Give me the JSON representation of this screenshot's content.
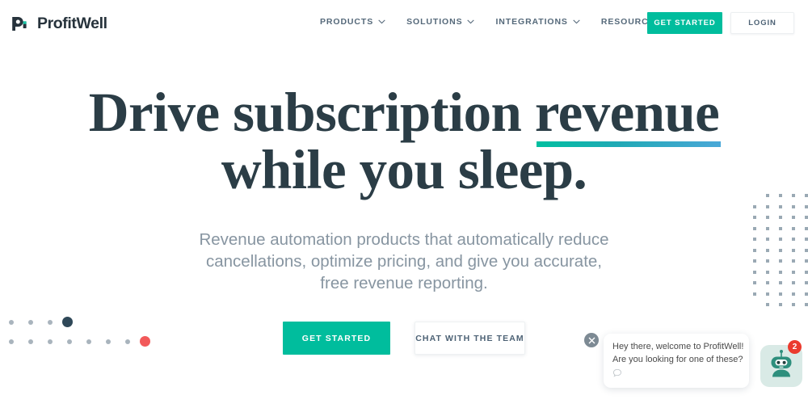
{
  "header": {
    "logo": {
      "text": "ProfitWell",
      "icon": "profitwell-logo-icon"
    },
    "nav": [
      {
        "label": "PRODUCTS",
        "icon": "chevron-down-icon"
      },
      {
        "label": "SOLUTIONS",
        "icon": "chevron-down-icon"
      },
      {
        "label": "INTEGRATIONS",
        "icon": "chevron-down-icon"
      },
      {
        "label": "RESOURCES",
        "icon": "chevron-down-icon"
      }
    ],
    "get_started_label": "GET STARTED",
    "login_label": "LOGIN"
  },
  "hero": {
    "title_line1_plain": "Drive subscription ",
    "title_line1_highlight": "revenue",
    "title_line2": "while you sleep.",
    "subtitle_line1": "Revenue automation products that automatically reduce",
    "subtitle_line2": "cancellations, optimize pricing, and give you accurate,",
    "subtitle_line3": "free revenue reporting.",
    "cta_primary_label": "GET STARTED",
    "cta_secondary_label": "CHAT WITH THE TEAM"
  },
  "chat": {
    "close_icon": "close-icon",
    "message_line1": "Hey there, welcome to ProfitWell!",
    "message_line2": "Are you looking for one of these?",
    "reply_icon": "speech-bubble-icon",
    "avatar_icon": "robot-avatar-icon",
    "badge_count": "2"
  },
  "colors": {
    "teal": "#00bd9d",
    "underline_start": "#00bfa0",
    "underline_end": "#4aa8d8",
    "headline": "#2b3d46",
    "subtitle": "#8795a1",
    "nav_text": "#55697a",
    "badge_red": "#eb3b2e",
    "dot_gray": "#a9b4bd",
    "dot_navy": "#2f4858",
    "dot_red": "#f2595a",
    "avatar_bg": "#d9eae6",
    "robot": "#2e8f7d"
  },
  "decor": {
    "dots_left_top_row": [
      "gray",
      "gray",
      "gray",
      "navy"
    ],
    "dots_left_bottom_row": [
      "gray",
      "gray",
      "gray",
      "gray",
      "gray",
      "gray",
      "gray",
      "red"
    ],
    "dots_grid_columns": 5,
    "dots_grid_rows": 11
  }
}
